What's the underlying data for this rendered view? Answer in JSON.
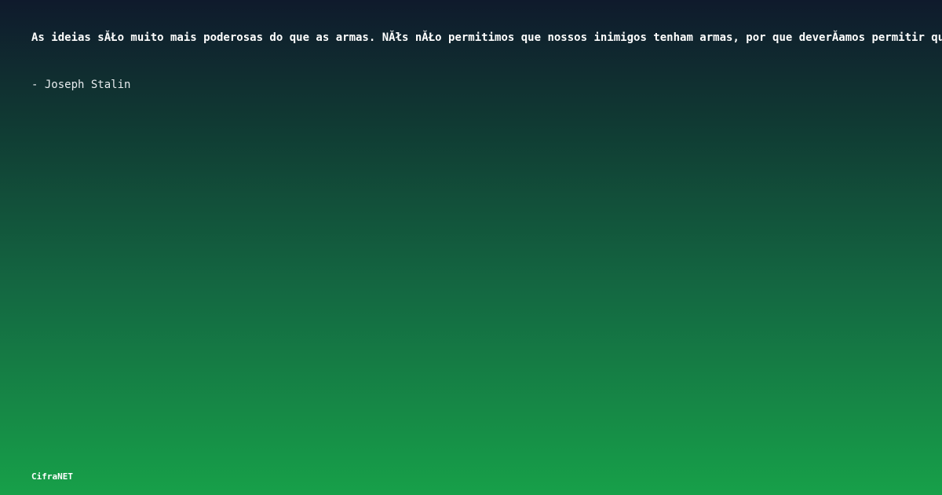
{
  "quote": {
    "text": "As ideias sĂŁo muito mais poderosas do que as armas. NĂłs nĂŁo permitimos que nossos inimigos tenham armas, por que deverĂ­amos permitir que tenham ideias?",
    "author": "- Joseph Stalin"
  },
  "footer": {
    "brand": "CifraNET"
  }
}
